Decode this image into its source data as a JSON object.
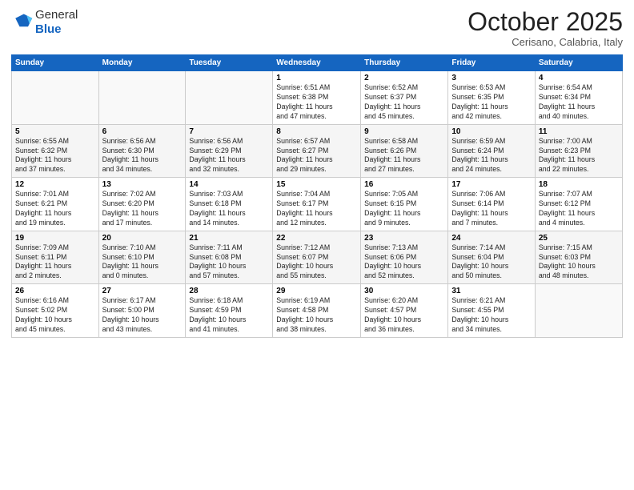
{
  "header": {
    "logo_line1": "General",
    "logo_line2": "Blue",
    "month": "October 2025",
    "location": "Cerisano, Calabria, Italy"
  },
  "weekdays": [
    "Sunday",
    "Monday",
    "Tuesday",
    "Wednesday",
    "Thursday",
    "Friday",
    "Saturday"
  ],
  "weeks": [
    [
      {
        "num": "",
        "info": ""
      },
      {
        "num": "",
        "info": ""
      },
      {
        "num": "",
        "info": ""
      },
      {
        "num": "1",
        "info": "Sunrise: 6:51 AM\nSunset: 6:38 PM\nDaylight: 11 hours\nand 47 minutes."
      },
      {
        "num": "2",
        "info": "Sunrise: 6:52 AM\nSunset: 6:37 PM\nDaylight: 11 hours\nand 45 minutes."
      },
      {
        "num": "3",
        "info": "Sunrise: 6:53 AM\nSunset: 6:35 PM\nDaylight: 11 hours\nand 42 minutes."
      },
      {
        "num": "4",
        "info": "Sunrise: 6:54 AM\nSunset: 6:34 PM\nDaylight: 11 hours\nand 40 minutes."
      }
    ],
    [
      {
        "num": "5",
        "info": "Sunrise: 6:55 AM\nSunset: 6:32 PM\nDaylight: 11 hours\nand 37 minutes."
      },
      {
        "num": "6",
        "info": "Sunrise: 6:56 AM\nSunset: 6:30 PM\nDaylight: 11 hours\nand 34 minutes."
      },
      {
        "num": "7",
        "info": "Sunrise: 6:56 AM\nSunset: 6:29 PM\nDaylight: 11 hours\nand 32 minutes."
      },
      {
        "num": "8",
        "info": "Sunrise: 6:57 AM\nSunset: 6:27 PM\nDaylight: 11 hours\nand 29 minutes."
      },
      {
        "num": "9",
        "info": "Sunrise: 6:58 AM\nSunset: 6:26 PM\nDaylight: 11 hours\nand 27 minutes."
      },
      {
        "num": "10",
        "info": "Sunrise: 6:59 AM\nSunset: 6:24 PM\nDaylight: 11 hours\nand 24 minutes."
      },
      {
        "num": "11",
        "info": "Sunrise: 7:00 AM\nSunset: 6:23 PM\nDaylight: 11 hours\nand 22 minutes."
      }
    ],
    [
      {
        "num": "12",
        "info": "Sunrise: 7:01 AM\nSunset: 6:21 PM\nDaylight: 11 hours\nand 19 minutes."
      },
      {
        "num": "13",
        "info": "Sunrise: 7:02 AM\nSunset: 6:20 PM\nDaylight: 11 hours\nand 17 minutes."
      },
      {
        "num": "14",
        "info": "Sunrise: 7:03 AM\nSunset: 6:18 PM\nDaylight: 11 hours\nand 14 minutes."
      },
      {
        "num": "15",
        "info": "Sunrise: 7:04 AM\nSunset: 6:17 PM\nDaylight: 11 hours\nand 12 minutes."
      },
      {
        "num": "16",
        "info": "Sunrise: 7:05 AM\nSunset: 6:15 PM\nDaylight: 11 hours\nand 9 minutes."
      },
      {
        "num": "17",
        "info": "Sunrise: 7:06 AM\nSunset: 6:14 PM\nDaylight: 11 hours\nand 7 minutes."
      },
      {
        "num": "18",
        "info": "Sunrise: 7:07 AM\nSunset: 6:12 PM\nDaylight: 11 hours\nand 4 minutes."
      }
    ],
    [
      {
        "num": "19",
        "info": "Sunrise: 7:09 AM\nSunset: 6:11 PM\nDaylight: 11 hours\nand 2 minutes."
      },
      {
        "num": "20",
        "info": "Sunrise: 7:10 AM\nSunset: 6:10 PM\nDaylight: 11 hours\nand 0 minutes."
      },
      {
        "num": "21",
        "info": "Sunrise: 7:11 AM\nSunset: 6:08 PM\nDaylight: 10 hours\nand 57 minutes."
      },
      {
        "num": "22",
        "info": "Sunrise: 7:12 AM\nSunset: 6:07 PM\nDaylight: 10 hours\nand 55 minutes."
      },
      {
        "num": "23",
        "info": "Sunrise: 7:13 AM\nSunset: 6:06 PM\nDaylight: 10 hours\nand 52 minutes."
      },
      {
        "num": "24",
        "info": "Sunrise: 7:14 AM\nSunset: 6:04 PM\nDaylight: 10 hours\nand 50 minutes."
      },
      {
        "num": "25",
        "info": "Sunrise: 7:15 AM\nSunset: 6:03 PM\nDaylight: 10 hours\nand 48 minutes."
      }
    ],
    [
      {
        "num": "26",
        "info": "Sunrise: 6:16 AM\nSunset: 5:02 PM\nDaylight: 10 hours\nand 45 minutes."
      },
      {
        "num": "27",
        "info": "Sunrise: 6:17 AM\nSunset: 5:00 PM\nDaylight: 10 hours\nand 43 minutes."
      },
      {
        "num": "28",
        "info": "Sunrise: 6:18 AM\nSunset: 4:59 PM\nDaylight: 10 hours\nand 41 minutes."
      },
      {
        "num": "29",
        "info": "Sunrise: 6:19 AM\nSunset: 4:58 PM\nDaylight: 10 hours\nand 38 minutes."
      },
      {
        "num": "30",
        "info": "Sunrise: 6:20 AM\nSunset: 4:57 PM\nDaylight: 10 hours\nand 36 minutes."
      },
      {
        "num": "31",
        "info": "Sunrise: 6:21 AM\nSunset: 4:55 PM\nDaylight: 10 hours\nand 34 minutes."
      },
      {
        "num": "",
        "info": ""
      }
    ]
  ]
}
